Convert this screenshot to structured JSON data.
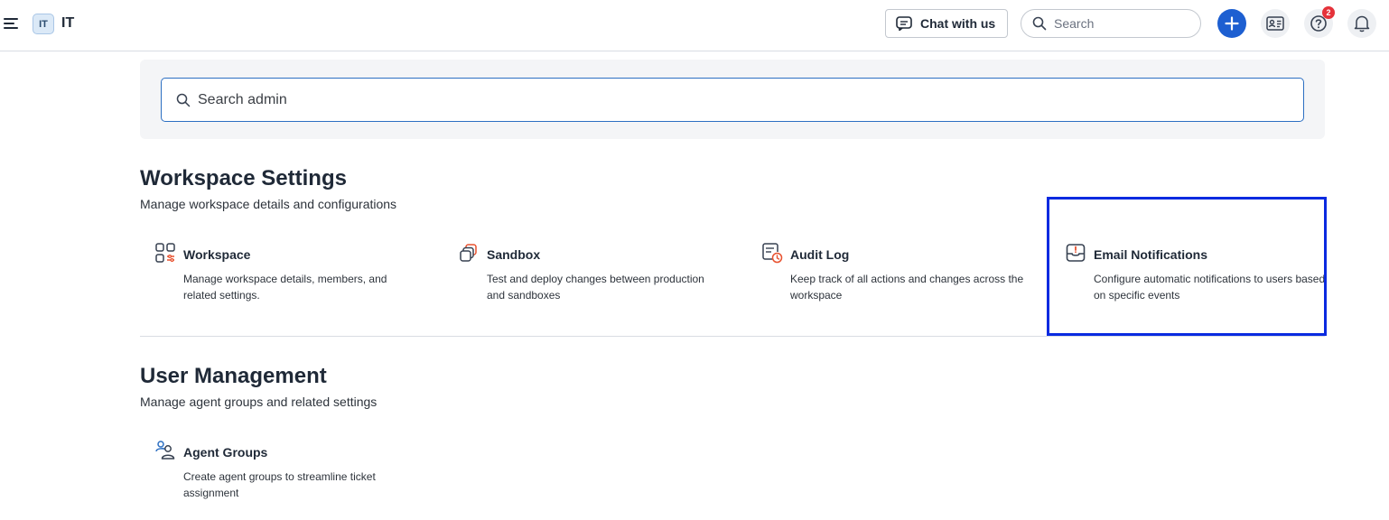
{
  "header": {
    "workspace_badge": "IT",
    "workspace_name": "IT",
    "chat_label": "Chat with us",
    "search_placeholder": "Search",
    "notification_count": "2"
  },
  "admin_search": {
    "placeholder": "Search admin"
  },
  "workspace_settings": {
    "title": "Workspace Settings",
    "subtitle": "Manage workspace details and configurations",
    "cards": [
      {
        "title": "Workspace",
        "description": "Manage workspace details, members, and related settings.",
        "icon": "workspace-icon"
      },
      {
        "title": "Sandbox",
        "description": "Test and deploy changes between production and sandboxes",
        "icon": "sandbox-icon"
      },
      {
        "title": "Audit Log",
        "description": "Keep track of all actions and changes across the workspace",
        "icon": "audit-log-icon"
      },
      {
        "title": "Email Notifications",
        "description": "Configure automatic notifications to users based on specific events",
        "icon": "email-inbox-icon"
      }
    ]
  },
  "user_management": {
    "title": "User Management",
    "subtitle": "Manage agent groups and related settings",
    "cards": [
      {
        "title": "Agent Groups",
        "description": "Create agent groups to streamline ticket assignment",
        "icon": "agent-groups-icon"
      }
    ]
  },
  "colors": {
    "primary": "#1d5fd1",
    "badge": "#e5323a",
    "accent_orange": "#e8512e",
    "highlight": "#0a2ae0"
  }
}
